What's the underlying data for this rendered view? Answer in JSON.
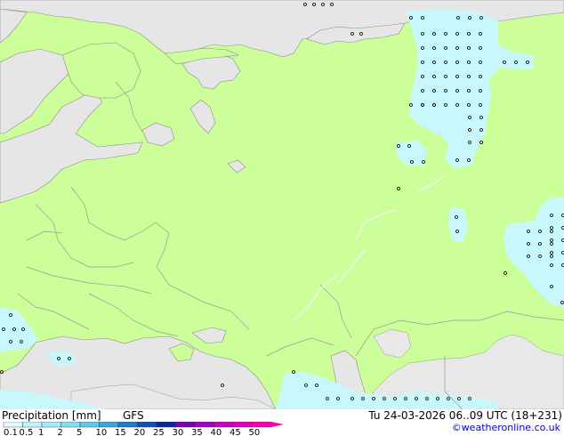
{
  "legend": {
    "title": "Precipitation [mm]",
    "model": "GFS",
    "valid_time": "Tu 24-03-2026 06..09 UTC (18+231)",
    "credit": "©weatheronline.co.uk",
    "levels": [
      "0.1",
      "0.5",
      "1",
      "2",
      "5",
      "10",
      "15",
      "20",
      "25",
      "30",
      "35",
      "40",
      "45",
      "50"
    ],
    "colors": [
      "#e0fbff",
      "#c0f4fc",
      "#a0ecf8",
      "#7fe0f2",
      "#5ccbeb",
      "#3aa6dd",
      "#1f7acf",
      "#1050bc",
      "#0a2a9c",
      "#7a00b8",
      "#a000c8",
      "#c800c8",
      "#e000c0",
      "#ff00b0"
    ]
  },
  "map_colors": {
    "land": "#ccff99",
    "sea": "#e6e6e6",
    "dry_land": "#e8e8e8",
    "light_precip": "#c8f8fc",
    "border": "#999999",
    "coast": "#8c8c8c"
  }
}
